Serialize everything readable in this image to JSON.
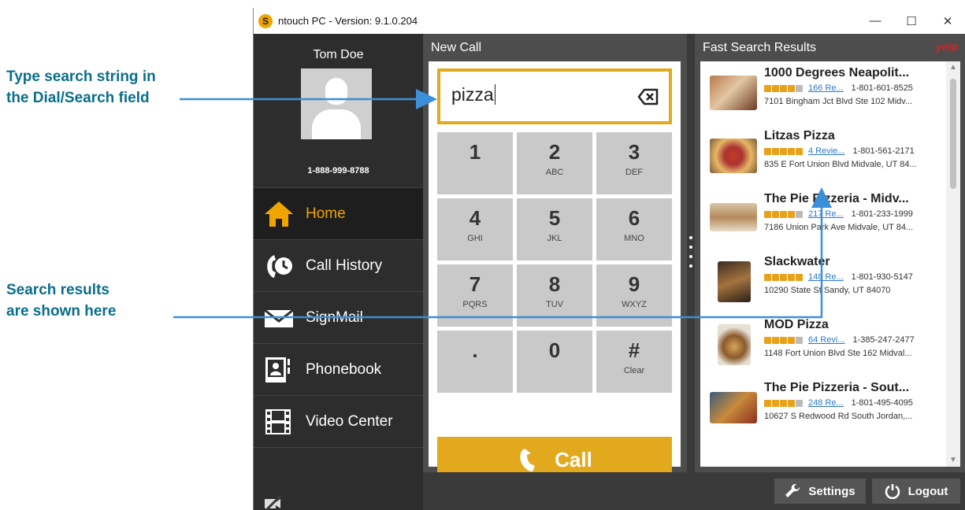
{
  "annotations": {
    "type_search": [
      "Type search string in",
      "the Dial/Search field"
    ],
    "results_shown": [
      "Search results",
      "are shown here"
    ]
  },
  "window": {
    "title": "ntouch PC  -  Version: 9.1.0.204",
    "minimize": "—",
    "maximize": "☐",
    "close": "✕"
  },
  "profile": {
    "name": "Tom Doe",
    "phone": "1-888-999-8788"
  },
  "nav": [
    {
      "label": "Home",
      "icon": "home-icon",
      "active": true
    },
    {
      "label": "Call History",
      "icon": "call-history-icon",
      "active": false
    },
    {
      "label": "SignMail",
      "icon": "envelope-icon",
      "active": false
    },
    {
      "label": "Phonebook",
      "icon": "phonebook-icon",
      "active": false
    },
    {
      "label": "Video Center",
      "icon": "film-icon",
      "active": false
    }
  ],
  "new_call": {
    "title": "New Call",
    "dial_value": "pizza",
    "keys": [
      {
        "digit": "1",
        "letters": ""
      },
      {
        "digit": "2",
        "letters": "ABC"
      },
      {
        "digit": "3",
        "letters": "DEF"
      },
      {
        "digit": "4",
        "letters": "GHI"
      },
      {
        "digit": "5",
        "letters": "JKL"
      },
      {
        "digit": "6",
        "letters": "MNO"
      },
      {
        "digit": "7",
        "letters": "PQRS"
      },
      {
        "digit": "8",
        "letters": "TUV"
      },
      {
        "digit": "9",
        "letters": "WXYZ"
      },
      {
        "digit": ".",
        "letters": ""
      },
      {
        "digit": "0",
        "letters": ""
      },
      {
        "digit": "#",
        "letters": "Clear"
      }
    ],
    "call_label": "Call"
  },
  "results": {
    "title": "Fast Search Results",
    "provider": "yelp",
    "items": [
      {
        "name": "1000 Degrees Neapolit...",
        "reviews": "166 Re...",
        "phone": "1-801-601-8525",
        "address": "7101 Bingham Jct Blvd Ste 102 Midv...",
        "rating": 4
      },
      {
        "name": "Litzas Pizza",
        "reviews": "4 Revie...",
        "phone": "1-801-561-2171",
        "address": "835 E Fort Union Blvd Midvale, UT 84...",
        "rating": 5
      },
      {
        "name": "The Pie Pizzeria - Midv...",
        "reviews": "217 Re...",
        "phone": "1-801-233-1999",
        "address": "7186 Union Park Ave Midvale, UT 84...",
        "rating": 4
      },
      {
        "name": "Slackwater",
        "reviews": "148 Re...",
        "phone": "1-801-930-5147",
        "address": "10290 State St Sandy, UT 84070",
        "rating": 5
      },
      {
        "name": "MOD Pizza",
        "reviews": "64 Revi...",
        "phone": "1-385-247-2477",
        "address": "1148 Fort Union Blvd Ste 162 Midval...",
        "rating": 4
      },
      {
        "name": "The Pie Pizzeria - Sout...",
        "reviews": "248 Re...",
        "phone": "1-801-495-4095",
        "address": "10627 S Redwood Rd South Jordan,...",
        "rating": 4
      }
    ]
  },
  "bottom": {
    "settings_label": "Settings",
    "logout_label": "Logout"
  },
  "colors": {
    "accent": "#e3a91c",
    "annotation": "#0a6e8c",
    "arrow": "#3b8fd9",
    "panel": "#4d4d4d",
    "sidebar": "#2d2d2d",
    "link": "#2c78c8"
  }
}
